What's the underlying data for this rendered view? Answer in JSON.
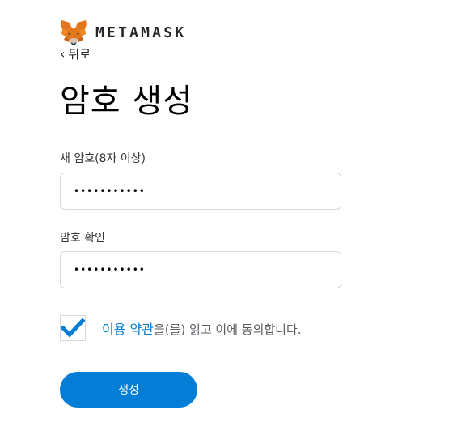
{
  "header": {
    "brand": "METAMASK",
    "logo_icon": "metamask-fox-icon"
  },
  "nav": {
    "back_label": "뒤로",
    "back_icon": "chevron-left-icon"
  },
  "page": {
    "title": "암호 생성"
  },
  "form": {
    "new_password": {
      "label": "새 암호(8자 이상)",
      "value": "•••••••••••"
    },
    "confirm_password": {
      "label": "암호 확인",
      "value": "•••••••••••"
    },
    "terms": {
      "checked": true,
      "link_text": "이용 약관",
      "suffix_text": "을(를) 읽고 이에 동의합니다."
    },
    "submit_label": "생성"
  },
  "colors": {
    "accent": "#037dd6",
    "checkmark": "#037dd6",
    "text": "#24272a",
    "border": "#d2d8dd"
  }
}
